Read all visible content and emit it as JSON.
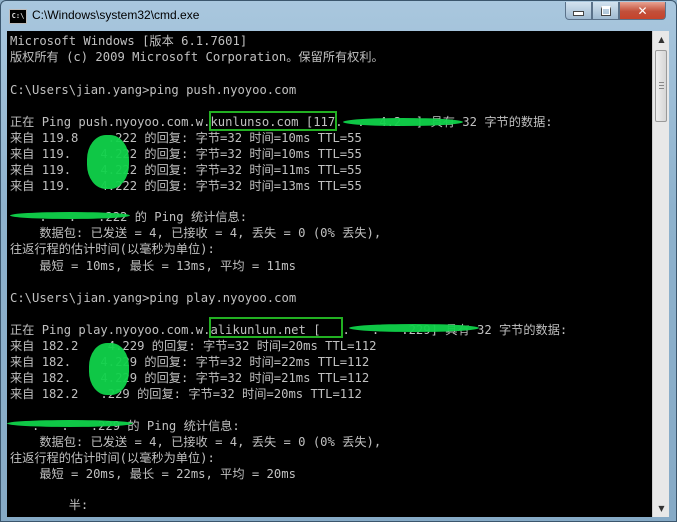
{
  "window": {
    "title": "C:\\Windows\\system32\\cmd.exe",
    "icon_text": "C:\\",
    "controls": {
      "minimize": "minimize",
      "maximize": "maximize",
      "close": "✕"
    }
  },
  "console": {
    "lines": [
      "Microsoft Windows [版本 6.1.7601]",
      "版权所有 (c) 2009 Microsoft Corporation。保留所有权利。",
      "",
      "C:\\Users\\jian.yang>ping push.nyoyoo.com",
      "",
      "正在 Ping push.nyoyoo.com.w.kunlunso.com [117.  .  4.2  ] 具有 32 字节的数据:",
      "来自 119.8    .222 的回复: 字节=32 时间=10ms TTL=55",
      "来自 119.    4.222 的回复: 字节=32 时间=10ms TTL=55",
      "来自 119.    4.222 的回复: 字节=32 时间=11ms TTL=55",
      "来自 119.    4.222 的回复: 字节=32 时间=13ms TTL=55",
      "",
      "    .   .   .222 的 Ping 统计信息:",
      "    数据包: 已发送 = 4, 已接收 = 4, 丢失 = 0 (0% 丢失),",
      "往返行程的估计时间(以毫秒为单位):",
      "    最短 = 10ms, 最长 = 13ms, 平均 = 11ms",
      "",
      "C:\\Users\\jian.yang>ping play.nyoyoo.com",
      "",
      "正在 Ping play.nyoyoo.com.w.alikunlun.net [   .   .   .229] 具有 32 字节的数据:",
      "来自 182.2    4.229 的回复: 字节=32 时间=20ms TTL=112",
      "来自 182.    4.229 的回复: 字节=32 时间=22ms TTL=112",
      "来自 182.    4.229 的回复: 字节=32 时间=21ms TTL=112",
      "来自 182.2   .229 的回复: 字节=32 时间=20ms TTL=112",
      "",
      "   .   .   .229 的 Ping 统计信息:",
      "    数据包: 已发送 = 4, 已接收 = 4, 丢失 = 0 (0% 丢失),",
      "往返行程的估计时间(以毫秒为单位):",
      "    最短 = 20ms, 最长 = 22ms, 平均 = 20ms",
      "",
      "",
      "        半:"
    ]
  }
}
